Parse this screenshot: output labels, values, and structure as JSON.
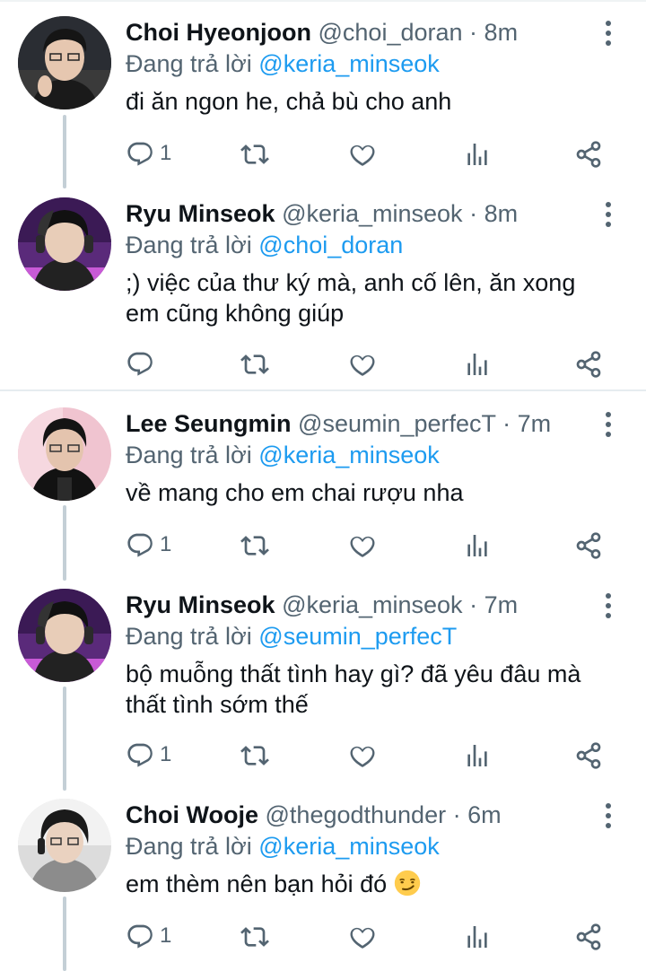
{
  "colors": {
    "accent": "#1d9bf0",
    "secondary_text": "#536471",
    "primary_text": "#0f1419",
    "thread_line": "#c4cfd6"
  },
  "replying_prefix": "Đang trả lời",
  "tweets": [
    {
      "name": "Choi Hyeonjoon",
      "handle": "@choi_doran",
      "time": "8m",
      "reply_to": "@keria_minseok",
      "text": "đi ăn ngon he, chả bù cho anh",
      "reply_count": "1",
      "avatar_icon": "avatar-photo"
    },
    {
      "name": "Ryu Minseok",
      "handle": "@keria_minseok",
      "time": "8m",
      "reply_to": "@choi_doran",
      "text": ";) việc của thư ký mà, anh cố lên, ăn xong em cũng không giúp",
      "reply_count": "",
      "avatar_icon": "avatar-photo"
    },
    {
      "name": "Lee Seungmin",
      "handle": "@seumin_perfecT",
      "time": "7m",
      "reply_to": "@keria_minseok",
      "text": "về mang cho em chai rượu nha",
      "reply_count": "1",
      "avatar_icon": "avatar-photo"
    },
    {
      "name": "Ryu Minseok",
      "handle": "@keria_minseok",
      "time": "7m",
      "reply_to": "@seumin_perfecT",
      "text": "bộ muỗng thất tình hay gì? đã yêu đâu mà thất tình sớm thế",
      "reply_count": "1",
      "avatar_icon": "avatar-photo"
    },
    {
      "name": "Choi Wooje",
      "handle": "@thegodthunder",
      "time": "6m",
      "reply_to": "@keria_minseok",
      "text": "em thèm nên bạn hỏi đó",
      "text_emoji": "smirking-face-emoji",
      "reply_count": "1",
      "avatar_icon": "avatar-photo"
    }
  ],
  "action_icons": [
    "reply-icon",
    "retweet-icon",
    "like-icon",
    "views-icon",
    "share-icon"
  ],
  "more_icon": "more-vertical-icon"
}
